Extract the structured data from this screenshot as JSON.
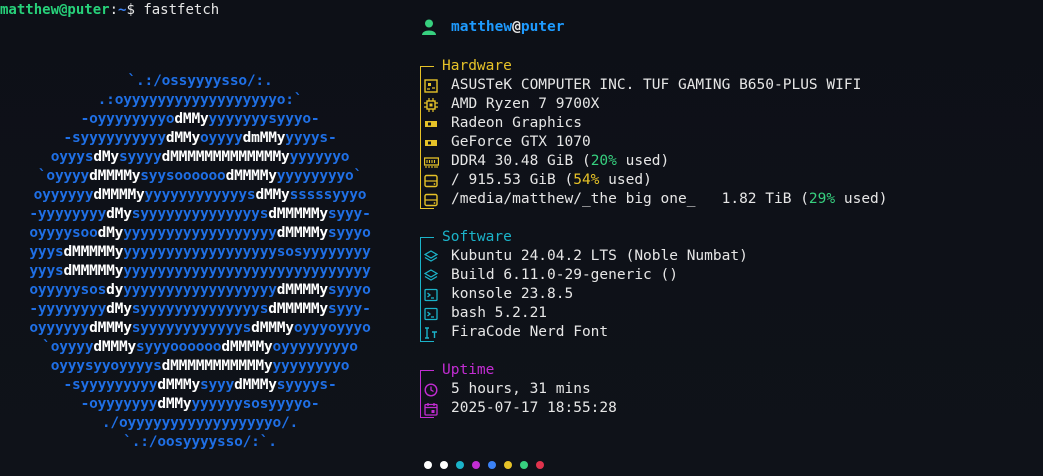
{
  "prompt": {
    "user_host": "matthew@puter",
    "colon": ":",
    "path": "~",
    "symbol": "$ ",
    "command": "fastfetch"
  },
  "logo": {
    "lines": [
      [
        [
          "b",
          "`.:/ossyyyysso/:."
        ]
      ],
      [
        [
          "b",
          ".:oyyyyyyyyyyyyyyyyyyo:`"
        ]
      ],
      [
        [
          "b",
          "-oyyyyyyyyo"
        ],
        [
          "w",
          "dMMy"
        ],
        [
          "b",
          "yyyyyyysyyyo-"
        ]
      ],
      [
        [
          "b",
          "-syyyyyyyyyy"
        ],
        [
          "w",
          "dMMy"
        ],
        [
          "b",
          "oyyyy"
        ],
        [
          "w",
          "dmMMy"
        ],
        [
          "b",
          "yyyys-"
        ]
      ],
      [
        [
          "b",
          "oyyys"
        ],
        [
          "w",
          "dMy"
        ],
        [
          "b",
          "syyyy"
        ],
        [
          "w",
          "dMMMMMMMMMMMMMy"
        ],
        [
          "b",
          "yyyyyyo"
        ]
      ],
      [
        [
          "b",
          "`oyyyy"
        ],
        [
          "w",
          "dMMMMy"
        ],
        [
          "b",
          "syysoooooo"
        ],
        [
          "w",
          "dMMMMy"
        ],
        [
          "b",
          "yyyyyyyyo`"
        ]
      ],
      [
        [
          "b",
          "oyyyyyy"
        ],
        [
          "w",
          "dMMMMy"
        ],
        [
          "b",
          "yyyyyyyyyyyys"
        ],
        [
          "w",
          "dMMy"
        ],
        [
          "b",
          "sssssyyyo"
        ]
      ],
      [
        [
          "b",
          "-yyyyyyyy"
        ],
        [
          "w",
          "dMy"
        ],
        [
          "b",
          "syyyyyyyyyyyyyys"
        ],
        [
          "w",
          "dMMMMMy"
        ],
        [
          "b",
          "syyy-"
        ]
      ],
      [
        [
          "b",
          "oyyyysoo"
        ],
        [
          "w",
          "dMy"
        ],
        [
          "b",
          "yyyyyyyyyyyyyyyyyy"
        ],
        [
          "w",
          "dMMMMy"
        ],
        [
          "b",
          "syyyo"
        ]
      ],
      [
        [
          "b",
          "yyys"
        ],
        [
          "w",
          "dMMMMMy"
        ],
        [
          "b",
          "yyyyyyyyyyyyyyyyyysosyyyyyyyy"
        ]
      ],
      [
        [
          "b",
          "yyys"
        ],
        [
          "w",
          "dMMMMMy"
        ],
        [
          "b",
          "yyyyyyyyyyyyyyyyyyyyyyyyyyyyy"
        ]
      ],
      [
        [
          "b",
          "oyyyyysos"
        ],
        [
          "w",
          "dy"
        ],
        [
          "b",
          "yyyyyyyyyyyyyyyyyy"
        ],
        [
          "w",
          "dMMMMy"
        ],
        [
          "b",
          "syyyo"
        ]
      ],
      [
        [
          "b",
          "-yyyyyyyy"
        ],
        [
          "w",
          "dMy"
        ],
        [
          "b",
          "syyyyyyyyyyyyyys"
        ],
        [
          "w",
          "dMMMMMy"
        ],
        [
          "b",
          "syyy-"
        ]
      ],
      [
        [
          "b",
          "oyyyyyy"
        ],
        [
          "w",
          "dMMMy"
        ],
        [
          "b",
          "syyyyyyyyyyyys"
        ],
        [
          "w",
          "dMMMy"
        ],
        [
          "b",
          "oyyyoyyyo"
        ]
      ],
      [
        [
          "b",
          "`oyyyy"
        ],
        [
          "w",
          "dMMMy"
        ],
        [
          "b",
          "syyyoooooo"
        ],
        [
          "w",
          "dMMMMy"
        ],
        [
          "b",
          "oyyyyyyyyo"
        ]
      ],
      [
        [
          "b",
          "oyyysyyoyyyys"
        ],
        [
          "w",
          "dMMMMMMMMMMMy"
        ],
        [
          "b",
          "yyyyyyyyo"
        ]
      ],
      [
        [
          "b",
          "-syyyyyyyyy"
        ],
        [
          "w",
          "dMMMy"
        ],
        [
          "b",
          "syyy"
        ],
        [
          "w",
          "dMMMy"
        ],
        [
          "b",
          "syyyys-"
        ]
      ],
      [
        [
          "b",
          "-oyyyyyyy"
        ],
        [
          "w",
          "dMMy"
        ],
        [
          "b",
          "yyyyyysosyyyyo-"
        ]
      ],
      [
        [
          "b",
          "./oyyyyyyyyyyyyyyyyyo/."
        ]
      ],
      [
        [
          "b",
          "`.:/oosyyyysso/:`."
        ]
      ]
    ]
  },
  "header": {
    "user": "matthew",
    "at": "@",
    "host": "puter"
  },
  "hardware": {
    "title": "Hardware",
    "rows": [
      {
        "icon": "motherboard-icon",
        "text": "ASUSTeK COMPUTER INC. TUF GAMING B650-PLUS WIFI"
      },
      {
        "icon": "cpu-icon",
        "text": "AMD Ryzen 7 9700X"
      },
      {
        "icon": "gpu-icon",
        "text": "Radeon Graphics"
      },
      {
        "icon": "gpu-icon",
        "text": "GeForce GTX 1070"
      },
      {
        "icon": "memory-icon",
        "pre": "DDR4 30.48 GiB (",
        "pct": "20%",
        "post": " used)",
        "pct_color": "green"
      },
      {
        "icon": "disk-icon",
        "pre": "/ 915.53 GiB (",
        "pct": "54%",
        "post": " used)",
        "pct_color": "yellow"
      },
      {
        "icon": "disk-icon",
        "pre": "/media/matthew/_the big one_   1.82 TiB (",
        "pct": "29%",
        "post": " used)",
        "pct_color": "green"
      }
    ]
  },
  "software": {
    "title": "Software",
    "rows": [
      {
        "icon": "layers-icon",
        "text": "Kubuntu 24.04.2 LTS (Noble Numbat)"
      },
      {
        "icon": "layers-icon",
        "text": "Build 6.11.0-29-generic ()"
      },
      {
        "icon": "terminal-icon",
        "text": "konsole 23.8.5"
      },
      {
        "icon": "terminal-icon",
        "text": "bash 5.2.21"
      },
      {
        "icon": "font-icon",
        "text": "FiraCode Nerd Font"
      }
    ]
  },
  "uptime": {
    "title": "Uptime",
    "rows": [
      {
        "icon": "clock-icon",
        "text": "5 hours, 31 mins"
      },
      {
        "icon": "calendar-icon",
        "text": "2025-07-17 18:55:28"
      }
    ]
  },
  "palette": [
    "#ffffff",
    "#ffffff",
    "#1bb3c9",
    "#c22dd2",
    "#3b82f6",
    "#e6c228",
    "#37d07f",
    "#e0334d"
  ],
  "colors": {
    "hardware": "#e6c228",
    "software": "#1bb3c9",
    "uptime": "#c22dd2",
    "title": "#1e9bff",
    "green": "#37d07f",
    "yellow": "#e6c228",
    "logo_blue": "#1f6fe5"
  }
}
